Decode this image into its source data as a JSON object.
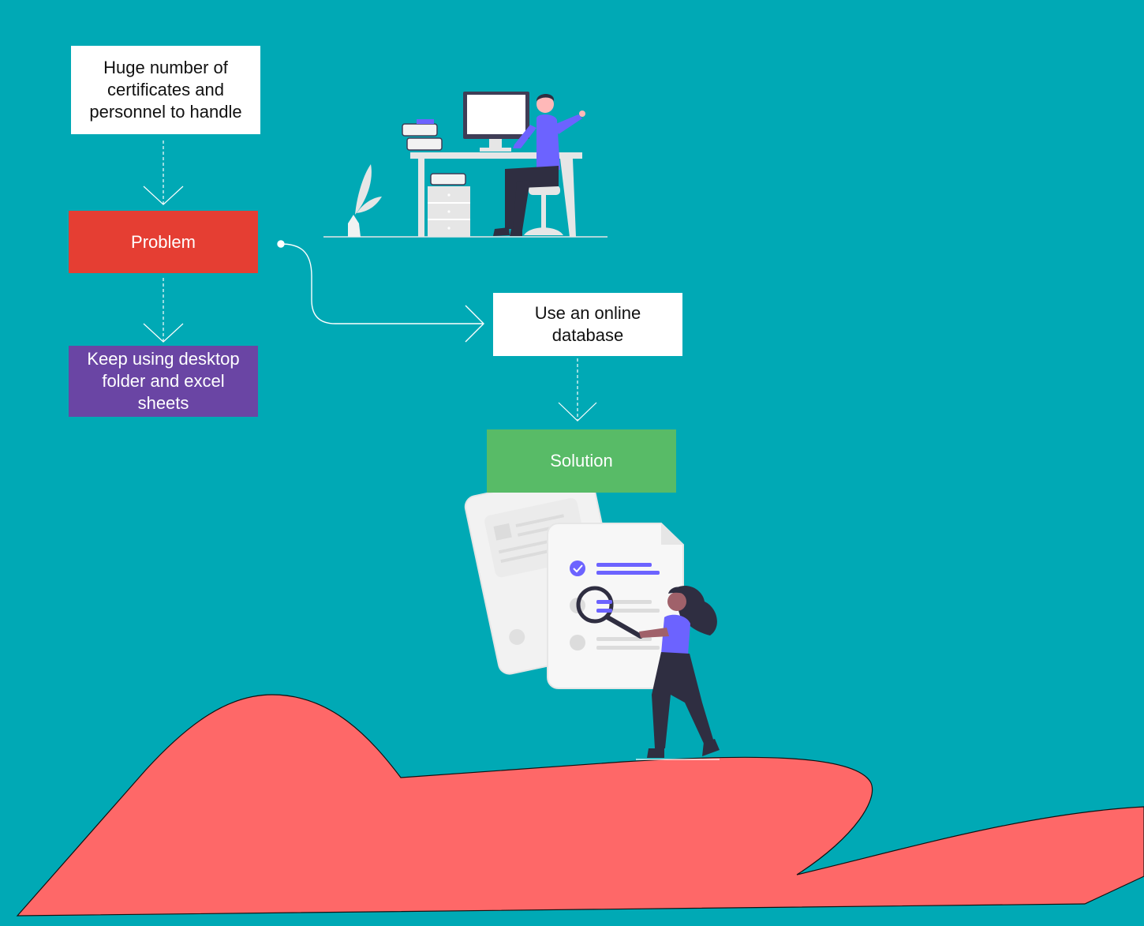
{
  "colors": {
    "background": "#00a9b5",
    "problem": "#e53e33",
    "keep_using": "#6a45a4",
    "solution": "#58bb67",
    "mountain": "#fe6868",
    "accent_purple": "#6c63ff",
    "dark": "#2f2e41"
  },
  "nodes": {
    "cause": "Huge number of certificates and personnel to handle",
    "problem": "Problem",
    "alternative": "Keep using desktop folder and excel sheets",
    "proposal": "Use an online database",
    "solution": "Solution"
  },
  "illustrations": {
    "top": "person-working-at-desk-illustration",
    "bottom": "person-inspecting-documents-with-magnifier-illustration",
    "landscape": "red-hill-shape"
  }
}
